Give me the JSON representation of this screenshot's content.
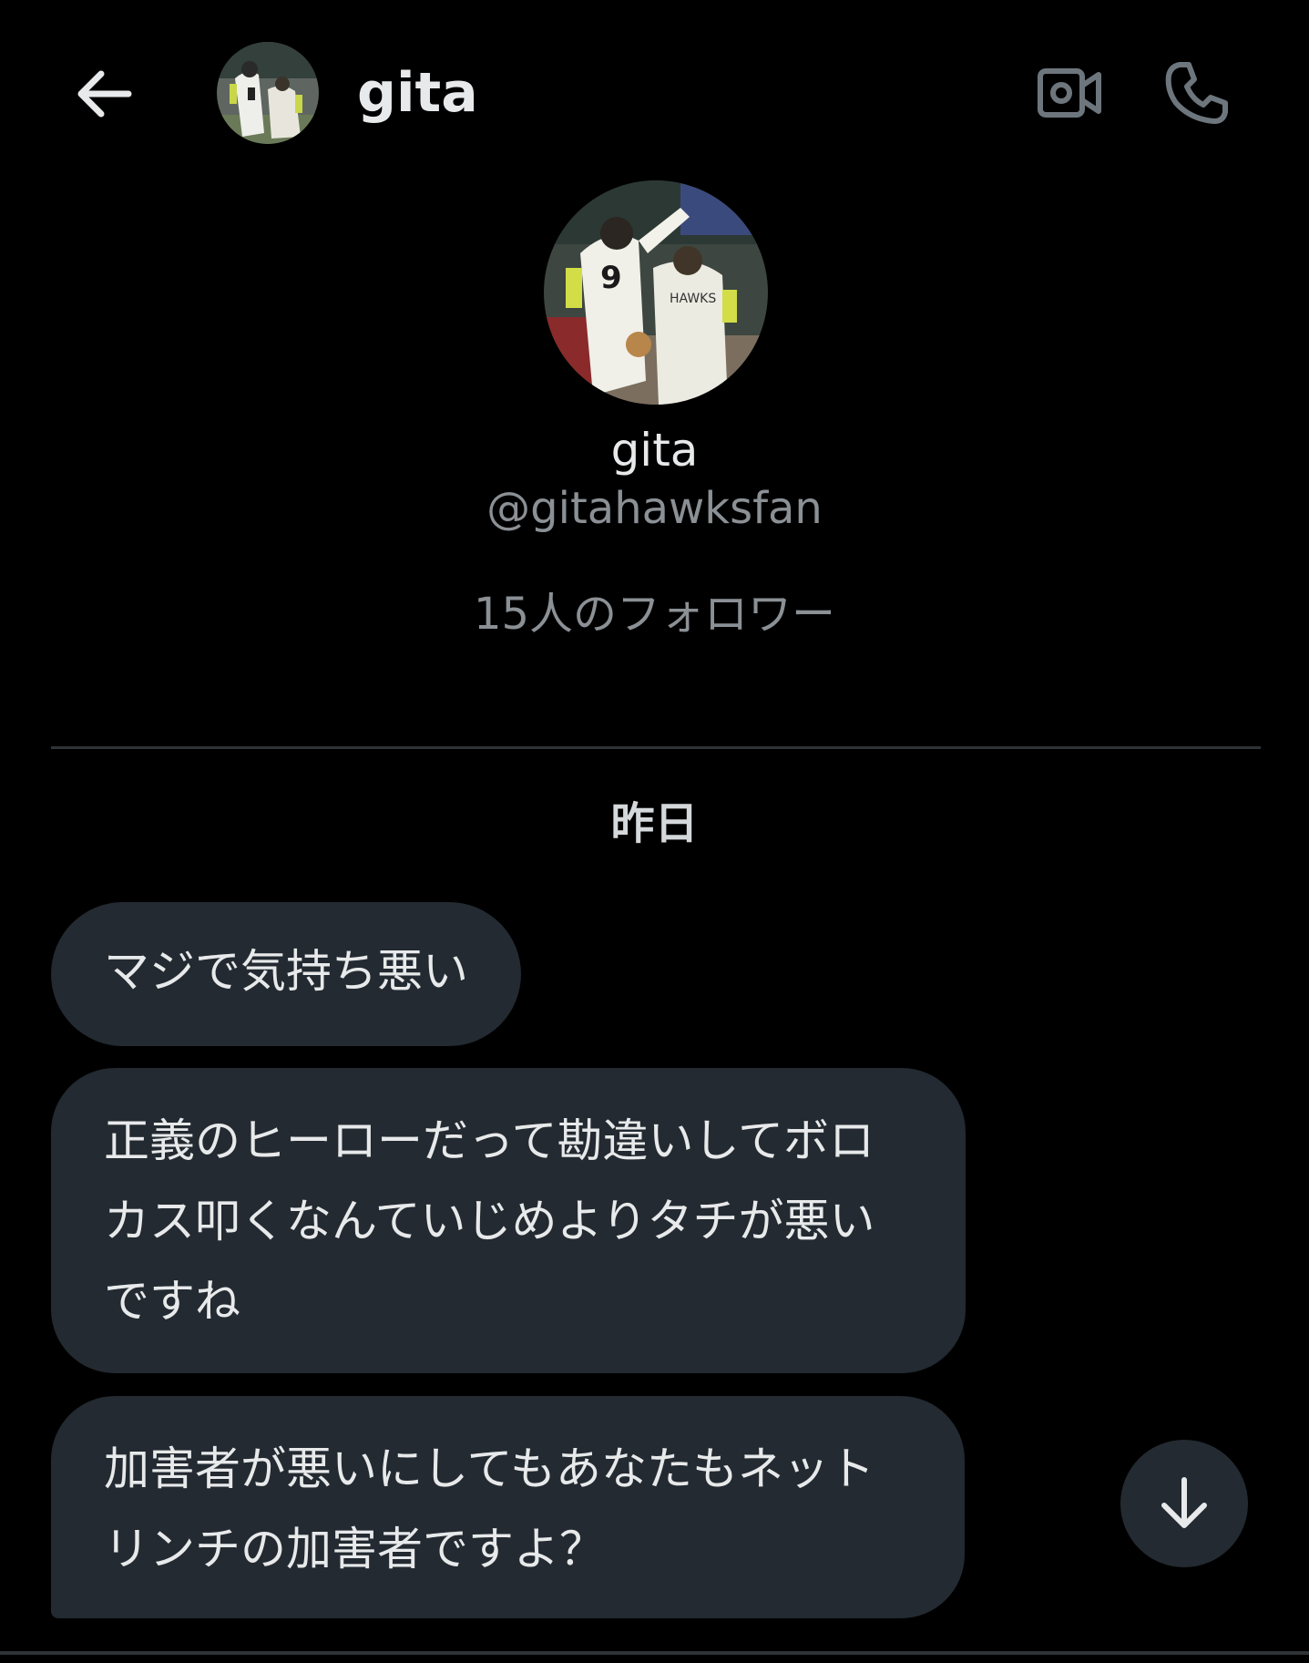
{
  "header": {
    "name": "gita",
    "back_icon": "arrow-left-icon",
    "video_icon": "video-camera-icon",
    "phone_icon": "phone-icon"
  },
  "profile": {
    "name": "gita",
    "handle": "@gitahawksfan",
    "followers": "15人のフォロワー"
  },
  "conversation": {
    "date_separator": "昨日",
    "messages": [
      {
        "text": "マジで気持ち悪い"
      },
      {
        "text": "正義のヒーローだって勘違いしてボロカス叩くなんていじめよりタチが悪いですね"
      },
      {
        "text": "加害者が悪いにしてもあなたもネットリンチの加害者ですよ？"
      }
    ]
  },
  "scroll_button": {
    "icon": "arrow-down-icon"
  },
  "colors": {
    "background": "#000000",
    "bubble": "#232a31",
    "text_primary": "#e7e9ea",
    "text_secondary": "#8b9095",
    "divider": "#2f3336"
  }
}
